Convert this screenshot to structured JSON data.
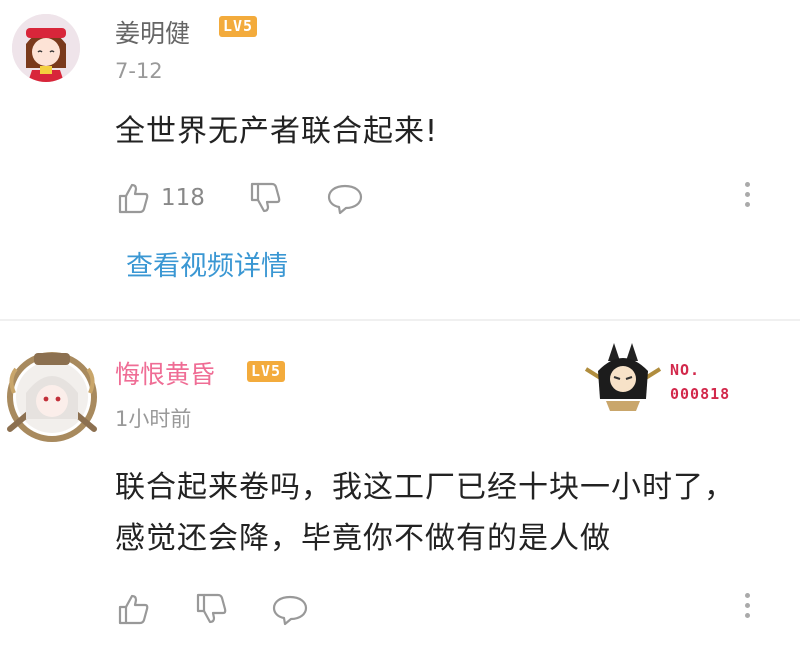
{
  "comments": [
    {
      "username": "姜明健",
      "level": "LV5",
      "time": "7-12",
      "text": "全世界无产者联合起来!",
      "like_count": "118",
      "view_link": "查看视频详情",
      "username_color": "#666666"
    },
    {
      "username": "悔恨黄昏",
      "level": "LV5",
      "time": "1小时前",
      "text": "联合起来卷吗，我这工厂已经十块一小时了，感觉还会降，毕竟你不做有的是人做",
      "username_color": "#ef6d95",
      "badge": {
        "no": "NO.",
        "number": "000818"
      }
    }
  ],
  "icons": [
    "like-icon",
    "dislike-icon",
    "reply-icon",
    "more-icon"
  ],
  "colors": {
    "link": "#3a97d3",
    "level_badge": "#f3ab3c",
    "vip_name": "#ef6d95",
    "badge_text": "#d2284b"
  }
}
